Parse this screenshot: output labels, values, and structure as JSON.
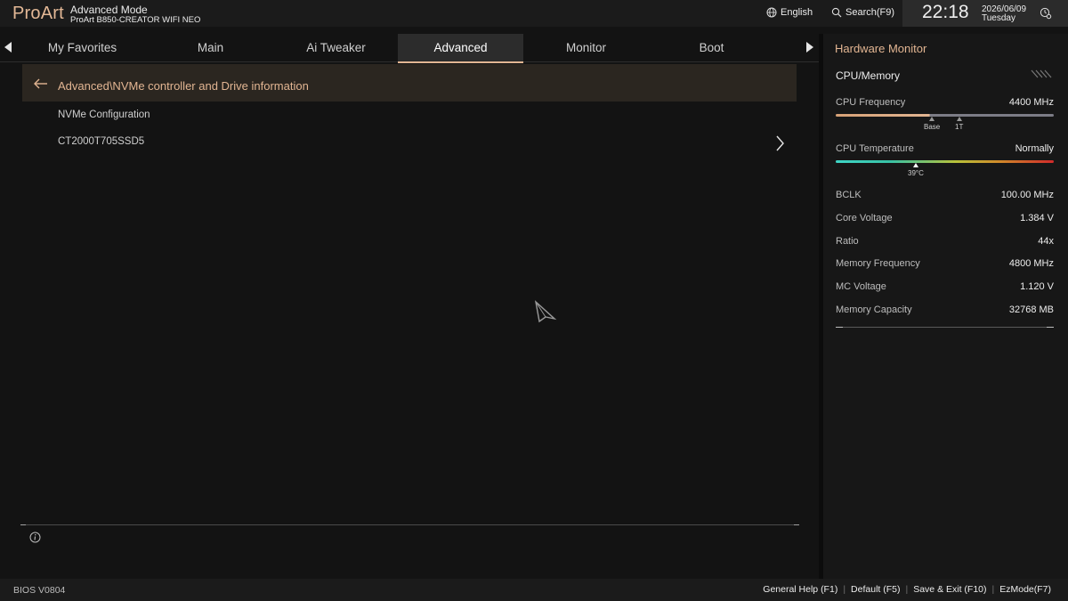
{
  "header": {
    "brand": "ProArt",
    "mode": "Advanced Mode",
    "board": "ProArt B850-CREATOR WIFI NEO",
    "language": "English",
    "search": "Search(F9)",
    "time": "22:18",
    "date": "2026/06/09",
    "day": "Tuesday"
  },
  "tabs": [
    {
      "label": "My Favorites",
      "active": false
    },
    {
      "label": "Main",
      "active": false
    },
    {
      "label": "Ai Tweaker",
      "active": false
    },
    {
      "label": "Advanced",
      "active": true
    },
    {
      "label": "Monitor",
      "active": false
    },
    {
      "label": "Boot",
      "active": false
    }
  ],
  "main": {
    "breadcrumb": "Advanced\\NVMe controller and Drive information",
    "items": [
      {
        "label": "NVMe Configuration"
      },
      {
        "label": "CT2000T705SSD5"
      }
    ]
  },
  "hardware_monitor": {
    "title": "Hardware Monitor",
    "section": "CPU/Memory",
    "cpu_frequency": {
      "label": "CPU Frequency",
      "value": "4400 MHz",
      "fill_fraction": 0.43,
      "markers": [
        "Base",
        "1T"
      ]
    },
    "cpu_temperature": {
      "label": "CPU Temperature",
      "value": "Normally",
      "reading": "39°C",
      "level_fraction": 0.37
    },
    "rows": [
      {
        "label": "BCLK",
        "value": "100.00 MHz"
      },
      {
        "label": "Core Voltage",
        "value": "1.384 V"
      },
      {
        "label": "Ratio",
        "value": "44x"
      },
      {
        "label": "Memory Frequency",
        "value": "4800 MHz"
      },
      {
        "label": "MC Voltage",
        "value": "1.120 V"
      },
      {
        "label": "Memory Capacity",
        "value": "32768 MB"
      }
    ]
  },
  "footer": {
    "bios_version": "BIOS V0804",
    "links": [
      "General Help (F1)",
      "Default (F5)",
      "Save & Exit (F10)",
      "EzMode(F7)"
    ]
  },
  "colors": {
    "accent": "#e2b592",
    "background": "#131313",
    "panel": "#171717",
    "breadcrumb_bg": "#2b2620"
  }
}
